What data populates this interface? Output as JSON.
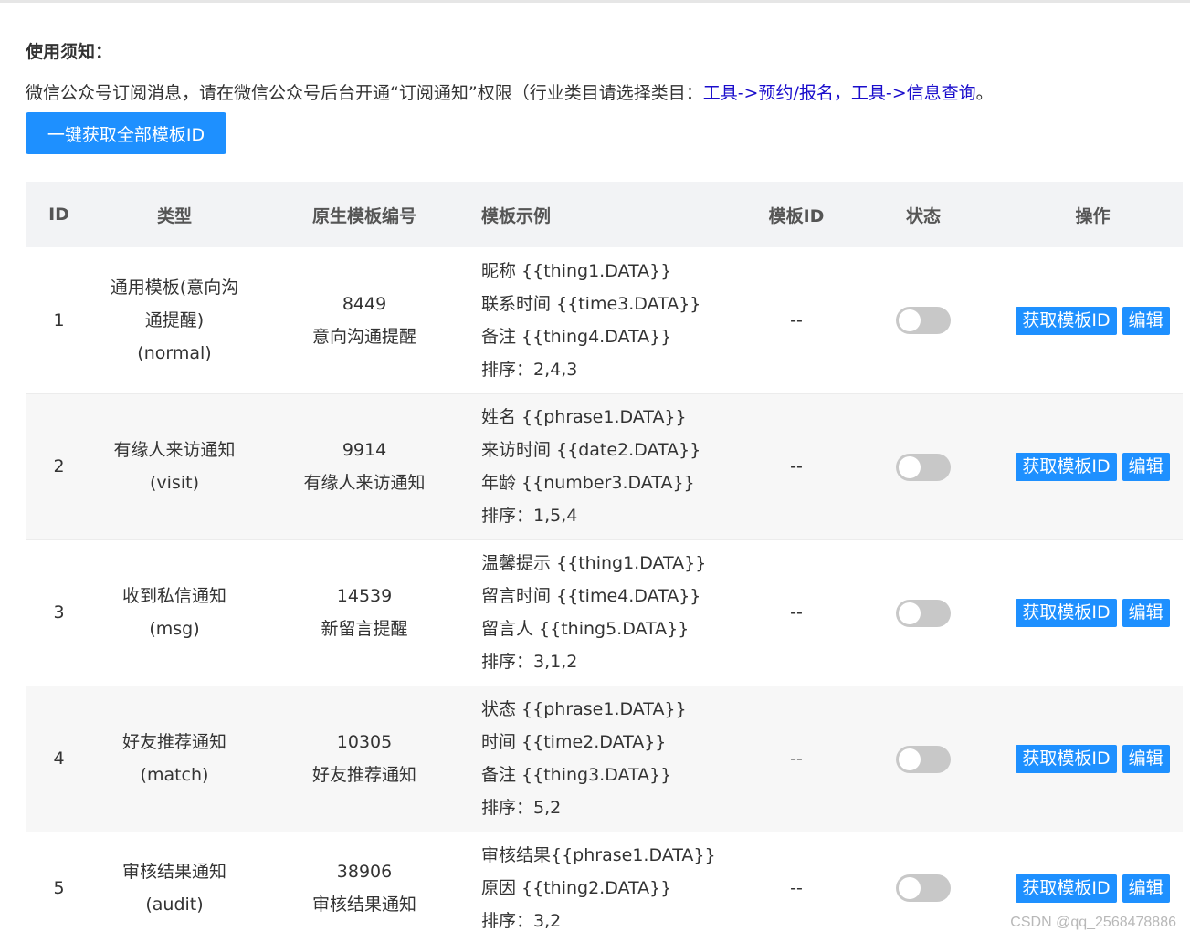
{
  "notice": {
    "title": "使用须知：",
    "text": "微信公众号订阅消息，请在微信公众号后台开通“订阅通知”权限（行业类目请选择类目：",
    "link": "工具->预约/报名，工具->信息查询",
    "end": "。"
  },
  "fetch_all_button": "一键获取全部模板ID",
  "table": {
    "headers": [
      "ID",
      "类型",
      "原生模板编号",
      "模板示例",
      "模板ID",
      "状态",
      "操作"
    ],
    "rows": [
      {
        "id": "1",
        "type_lines": [
          "通用模板(意向沟",
          "通提醒)",
          "(normal)"
        ],
        "native_no": "8449",
        "native_name": "意向沟通提醒",
        "example": [
          "昵称 {{thing1.DATA}}",
          "联系时间 {{time3.DATA}}",
          "备注 {{thing4.DATA}}",
          "排序：2,4,3"
        ],
        "template_id": "--",
        "status": false
      },
      {
        "id": "2",
        "type_lines": [
          "有缘人来访通知",
          "(visit)"
        ],
        "native_no": "9914",
        "native_name": "有缘人来访通知",
        "example": [
          "姓名 {{phrase1.DATA}}",
          "来访时间 {{date2.DATA}}",
          "年龄 {{number3.DATA}}",
          "排序：1,5,4"
        ],
        "template_id": "--",
        "status": false
      },
      {
        "id": "3",
        "type_lines": [
          "收到私信通知",
          "(msg)"
        ],
        "native_no": "14539",
        "native_name": "新留言提醒",
        "example": [
          "温馨提示 {{thing1.DATA}}",
          "留言时间 {{time4.DATA}}",
          "留言人 {{thing5.DATA}}",
          "排序：3,1,2"
        ],
        "template_id": "--",
        "status": false
      },
      {
        "id": "4",
        "type_lines": [
          "好友推荐通知",
          "(match)"
        ],
        "native_no": "10305",
        "native_name": "好友推荐通知",
        "example": [
          "状态 {{phrase1.DATA}}",
          "时间 {{time2.DATA}}",
          "备注 {{thing3.DATA}}",
          "排序：5,2"
        ],
        "template_id": "--",
        "status": false
      },
      {
        "id": "5",
        "type_lines": [
          "审核结果通知",
          "(audit)"
        ],
        "native_no": "38906",
        "native_name": "审核结果通知",
        "example": [
          "审核结果{{phrase1.DATA}}",
          "原因 {{thing2.DATA}}",
          "排序：3,2"
        ],
        "template_id": "--",
        "status": false
      }
    ],
    "actions": {
      "get_id": "获取模板ID",
      "edit": "编辑"
    }
  },
  "colors": {
    "primary": "#1e90ff",
    "link": "#1a0dcc",
    "header_bg": "#f2f3f5",
    "alt_row_bg": "#f7f7f7",
    "toggle_off": "#c8c8c8"
  },
  "watermark": "CSDN @qq_2568478886"
}
